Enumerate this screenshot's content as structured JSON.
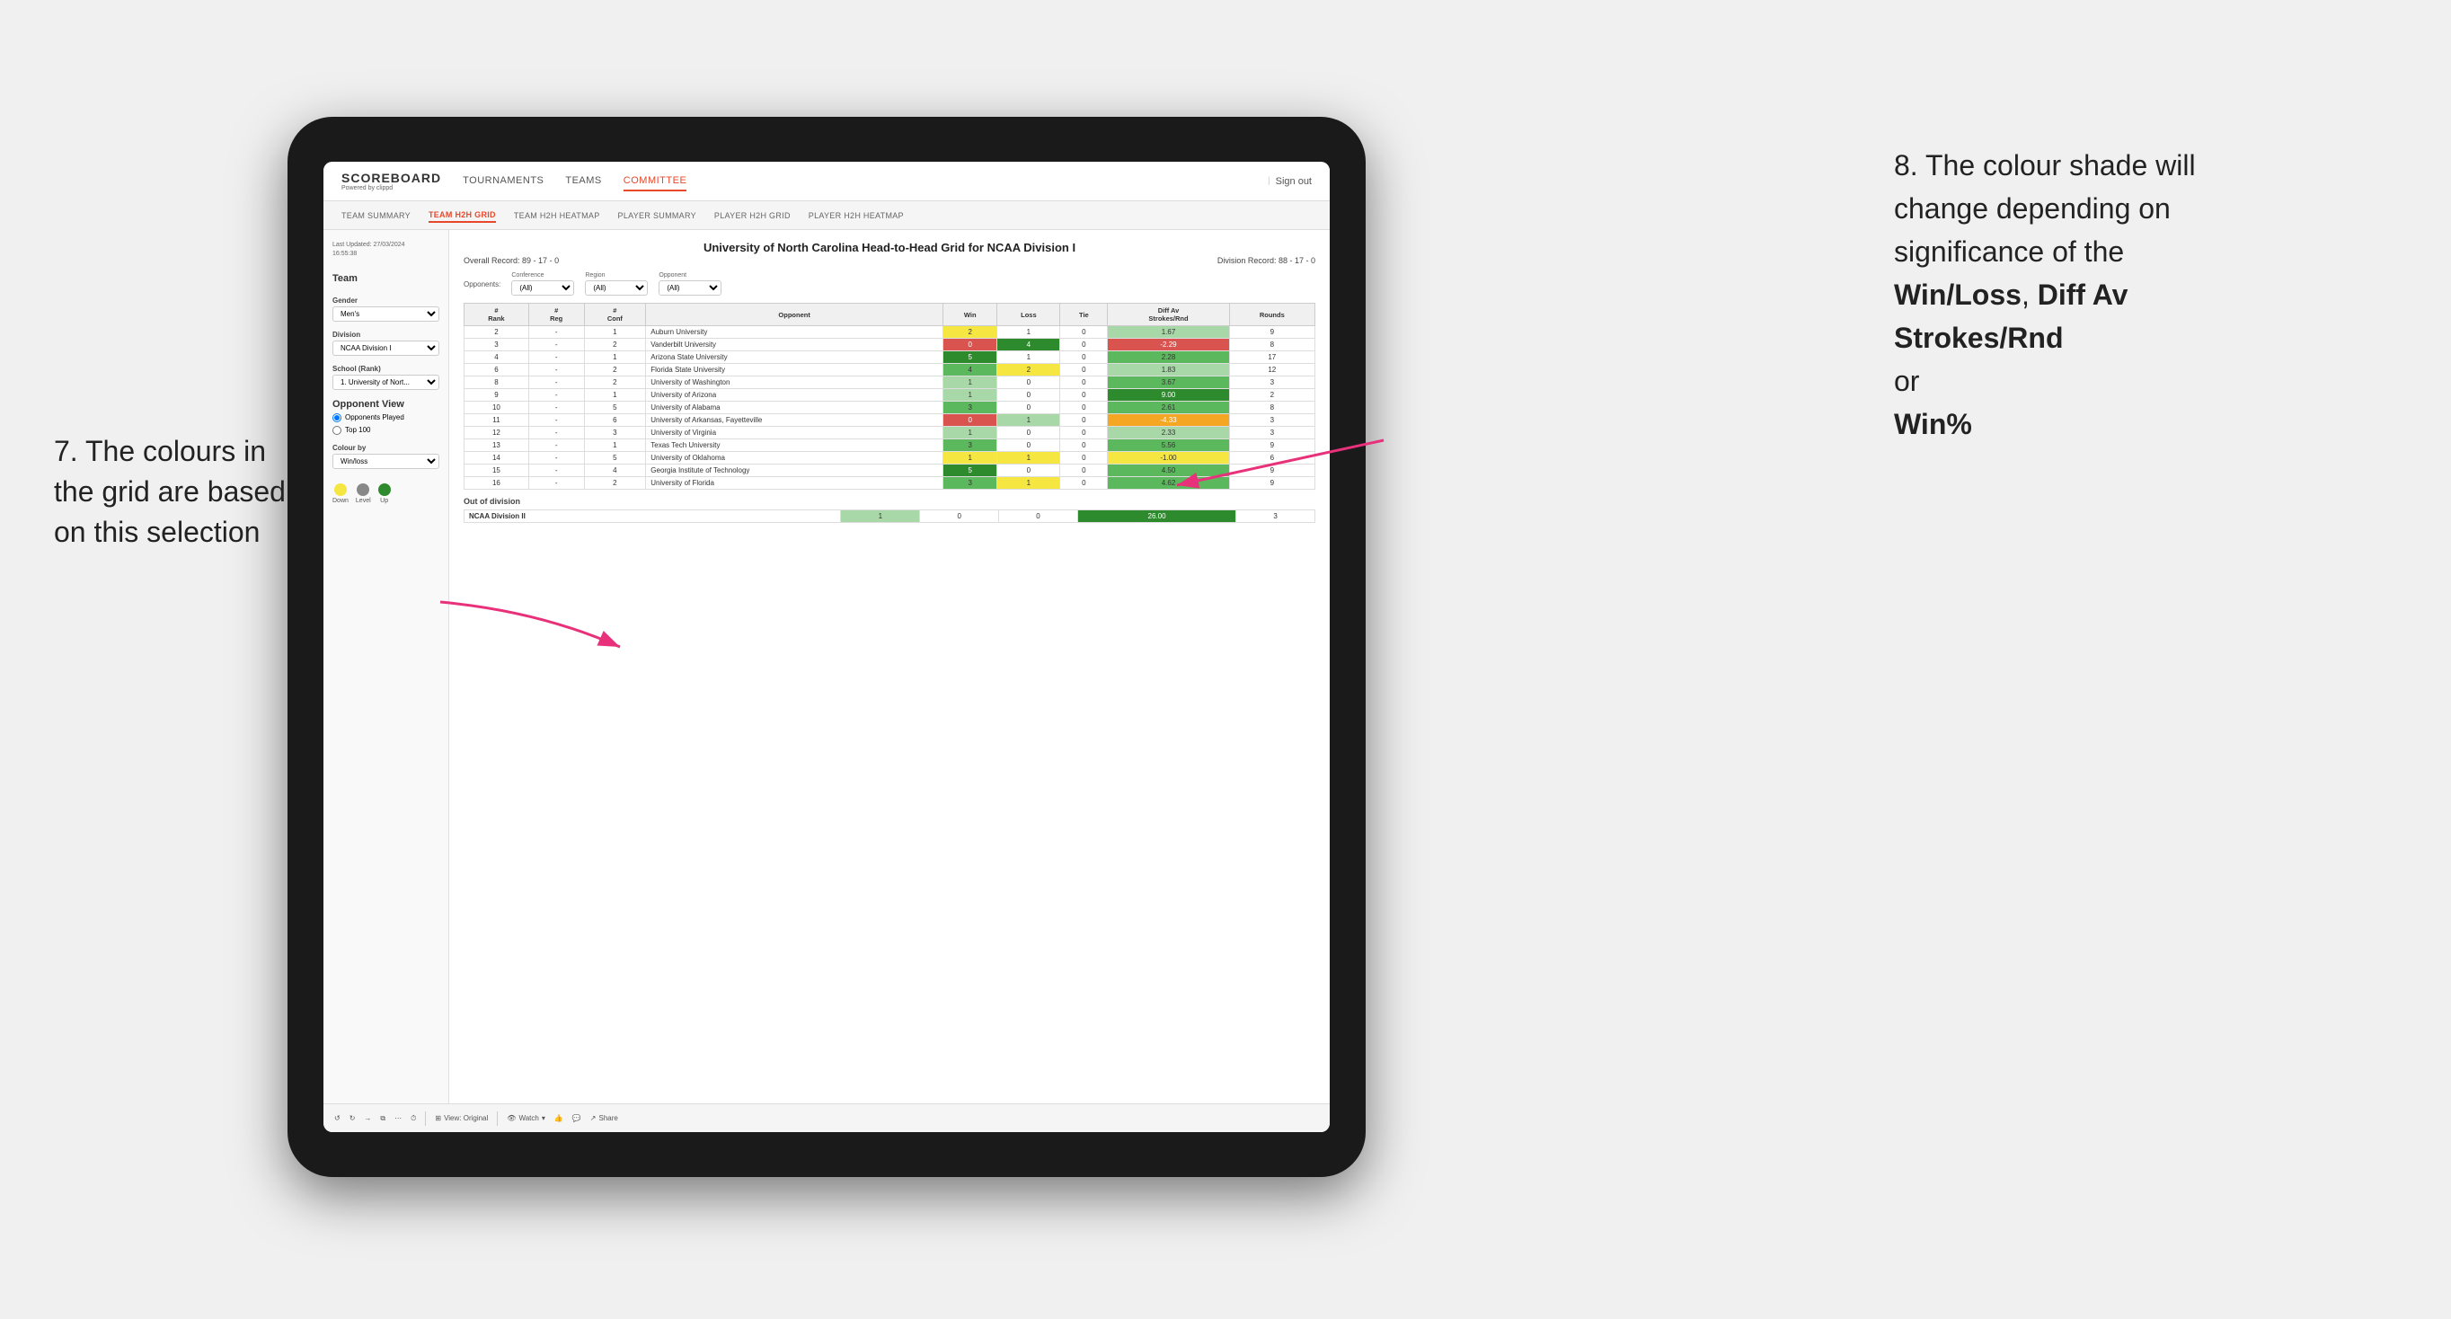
{
  "annotations": {
    "left_text": "7. The colours in the grid are based on this selection",
    "right_text_1": "8. The colour shade will change depending on significance of the",
    "right_bold_1": "Win/Loss",
    "right_text_2": ", ",
    "right_bold_2": "Diff Av Strokes/Rnd",
    "right_text_3": " or",
    "right_bold_3": "Win%"
  },
  "nav": {
    "logo": "SCOREBOARD",
    "logo_sub": "Powered by clippd",
    "sign_out": "Sign out",
    "items": [
      {
        "label": "TOURNAMENTS",
        "active": false
      },
      {
        "label": "TEAMS",
        "active": false
      },
      {
        "label": "COMMITTEE",
        "active": true
      }
    ]
  },
  "sub_nav": {
    "items": [
      {
        "label": "TEAM SUMMARY",
        "active": false
      },
      {
        "label": "TEAM H2H GRID",
        "active": true
      },
      {
        "label": "TEAM H2H HEATMAP",
        "active": false
      },
      {
        "label": "PLAYER SUMMARY",
        "active": false
      },
      {
        "label": "PLAYER H2H GRID",
        "active": false
      },
      {
        "label": "PLAYER H2H HEATMAP",
        "active": false
      }
    ]
  },
  "left_panel": {
    "last_updated_label": "Last Updated: 27/03/2024",
    "last_updated_time": "16:55:38",
    "team_label": "Team",
    "gender_label": "Gender",
    "gender_value": "Men's",
    "division_label": "Division",
    "division_value": "NCAA Division I",
    "school_label": "School (Rank)",
    "school_value": "1. University of Nort...",
    "opponent_view_label": "Opponent View",
    "opponent_played": "Opponents Played",
    "top100": "Top 100",
    "colour_by_label": "Colour by",
    "colour_by_value": "Win/loss",
    "legend": {
      "down_label": "Down",
      "level_label": "Level",
      "up_label": "Up"
    }
  },
  "grid": {
    "title": "University of North Carolina Head-to-Head Grid for NCAA Division I",
    "overall_record_label": "Overall Record:",
    "overall_record": "89 - 17 - 0",
    "division_record_label": "Division Record:",
    "division_record": "88 - 17 - 0",
    "filters": {
      "opponents_label": "Opponents:",
      "conference_label": "Conference",
      "conference_value": "(All)",
      "region_label": "Region",
      "region_value": "(All)",
      "opponent_label": "Opponent",
      "opponent_value": "(All)"
    },
    "columns": [
      "#\nRank",
      "#\nReg",
      "#\nConf",
      "Opponent",
      "Win",
      "Loss",
      "Tie",
      "Diff Av\nStrokes/Rnd",
      "Rounds"
    ],
    "rows": [
      {
        "rank": "2",
        "reg": "-",
        "conf": "1",
        "opponent": "Auburn University",
        "win": 2,
        "loss": 1,
        "tie": 0,
        "diff": "1.67",
        "rounds": 9,
        "win_color": "yellow",
        "loss_color": "white",
        "diff_color": "green_light"
      },
      {
        "rank": "3",
        "reg": "-",
        "conf": "2",
        "opponent": "Vanderbilt University",
        "win": 0,
        "loss": 4,
        "tie": 0,
        "diff": "-2.29",
        "rounds": 8,
        "win_color": "red",
        "loss_color": "green_dark",
        "diff_color": "red"
      },
      {
        "rank": "4",
        "reg": "-",
        "conf": "1",
        "opponent": "Arizona State University",
        "win": 5,
        "loss": 1,
        "tie": 0,
        "diff": "2.28",
        "rounds": 17,
        "win_color": "green_dark",
        "loss_color": "white",
        "diff_color": "green_med"
      },
      {
        "rank": "6",
        "reg": "-",
        "conf": "2",
        "opponent": "Florida State University",
        "win": 4,
        "loss": 2,
        "tie": 0,
        "diff": "1.83",
        "rounds": 12,
        "win_color": "green_med",
        "loss_color": "yellow",
        "diff_color": "green_light"
      },
      {
        "rank": "8",
        "reg": "-",
        "conf": "2",
        "opponent": "University of Washington",
        "win": 1,
        "loss": 0,
        "tie": 0,
        "diff": "3.67",
        "rounds": 3,
        "win_color": "green_light",
        "loss_color": "white",
        "diff_color": "green_med"
      },
      {
        "rank": "9",
        "reg": "-",
        "conf": "1",
        "opponent": "University of Arizona",
        "win": 1,
        "loss": 0,
        "tie": 0,
        "diff": "9.00",
        "rounds": 2,
        "win_color": "green_light",
        "loss_color": "white",
        "diff_color": "green_dark"
      },
      {
        "rank": "10",
        "reg": "-",
        "conf": "5",
        "opponent": "University of Alabama",
        "win": 3,
        "loss": 0,
        "tie": 0,
        "diff": "2.61",
        "rounds": 8,
        "win_color": "green_med",
        "loss_color": "white",
        "diff_color": "green_med"
      },
      {
        "rank": "11",
        "reg": "-",
        "conf": "6",
        "opponent": "University of Arkansas, Fayetteville",
        "win": 0,
        "loss": 1,
        "tie": 0,
        "diff": "-4.33",
        "rounds": 3,
        "win_color": "red",
        "loss_color": "green_light",
        "diff_color": "orange"
      },
      {
        "rank": "12",
        "reg": "-",
        "conf": "3",
        "opponent": "University of Virginia",
        "win": 1,
        "loss": 0,
        "tie": 0,
        "diff": "2.33",
        "rounds": 3,
        "win_color": "green_light",
        "loss_color": "white",
        "diff_color": "green_light"
      },
      {
        "rank": "13",
        "reg": "-",
        "conf": "1",
        "opponent": "Texas Tech University",
        "win": 3,
        "loss": 0,
        "tie": 0,
        "diff": "5.56",
        "rounds": 9,
        "win_color": "green_med",
        "loss_color": "white",
        "diff_color": "green_med"
      },
      {
        "rank": "14",
        "reg": "-",
        "conf": "5",
        "opponent": "University of Oklahoma",
        "win": 1,
        "loss": 1,
        "tie": 0,
        "diff": "-1.00",
        "rounds": 6,
        "win_color": "yellow",
        "loss_color": "yellow",
        "diff_color": "yellow"
      },
      {
        "rank": "15",
        "reg": "-",
        "conf": "4",
        "opponent": "Georgia Institute of Technology",
        "win": 5,
        "loss": 0,
        "tie": 0,
        "diff": "4.50",
        "rounds": 9,
        "win_color": "green_dark",
        "loss_color": "white",
        "diff_color": "green_med"
      },
      {
        "rank": "16",
        "reg": "-",
        "conf": "2",
        "opponent": "University of Florida",
        "win": 3,
        "loss": 1,
        "tie": 0,
        "diff": "4.62",
        "rounds": 9,
        "win_color": "green_med",
        "loss_color": "yellow",
        "diff_color": "green_med"
      }
    ],
    "out_of_division_label": "Out of division",
    "out_of_division_rows": [
      {
        "name": "NCAA Division II",
        "win": 1,
        "loss": 0,
        "tie": 0,
        "diff": "26.00",
        "rounds": 3,
        "win_color": "green_light",
        "diff_color": "green_dark"
      }
    ]
  },
  "toolbar": {
    "view_label": "View: Original",
    "watch_label": "Watch",
    "share_label": "Share"
  }
}
